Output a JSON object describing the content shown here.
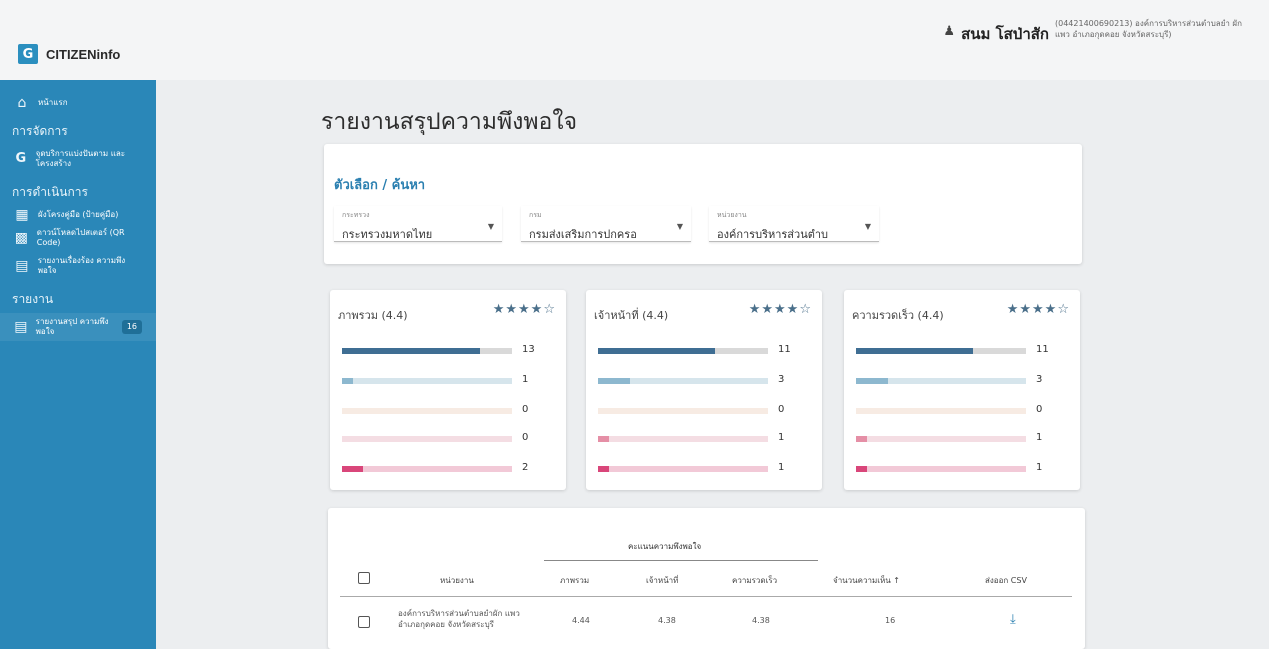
{
  "header": {
    "brand_logo": "G",
    "brand": "CITIZENinfo",
    "user_name": "สนม โสป่าสัก",
    "user_org": "(04421400690213) องค์การบริหารส่วนตำบลยำ ผักแพว อำเภอกุดคอย จังหวัดสระบุรี)"
  },
  "sidebar": {
    "home": "หน้าแรก",
    "section_manage": "การจัดการ",
    "manage_item": "จุดบริการแบ่งปันตาม และโครงสร้าง",
    "section_operation": "การดำเนินการ",
    "op_items": [
      "ผังโครงคู่มือ (ป้ายคู่มือ)",
      "ดาวน์โหลดไปสเตอร์ (QR Code)",
      "รายงานเรื่องร้อง ความพึงพอใจ"
    ],
    "section_report": "รายงาน",
    "report_item": "รายงานสรุป ความพึงพอใจ",
    "report_badge": "16"
  },
  "page": {
    "title": "รายงานสรุปความพึงพอใจ"
  },
  "filter": {
    "title": "ตัวเลือก / ค้นหา",
    "ministry_label": "กระทรวง",
    "ministry_value": "กระทรวงมหาดไทย",
    "department_label": "กรม",
    "department_value": "กรมส่งเสริมการปกครอ",
    "agency_label": "หน่วยงาน",
    "agency_value": "องค์การบริหารส่วนตำบ"
  },
  "ratings": [
    {
      "title": "ภาพรวม (4.4)",
      "stars": "★★★★☆",
      "rating": 4.4,
      "counts": [
        13,
        1,
        0,
        0,
        2
      ]
    },
    {
      "title": "เจ้าหน้าที่ (4.4)",
      "stars": "★★★★☆",
      "rating": 4.4,
      "counts": [
        11,
        3,
        0,
        1,
        1
      ]
    },
    {
      "title": "ความรวดเร็ว (4.4)",
      "stars": "★★★★☆",
      "rating": 4.4,
      "counts": [
        11,
        3,
        0,
        1,
        1
      ]
    }
  ],
  "bar_colors": [
    "#3f6e93",
    "#8db8cf",
    "#f3d9c8",
    "#e58fa6",
    "#d9467a"
  ],
  "bar_track_colors": [
    "#d9d9d9",
    "#d6e5ec",
    "#f7ebe3",
    "#f4dde3",
    "#f2c9d7"
  ],
  "table": {
    "group_header": "คะแนนความพึงพอใจ",
    "col_agency": "หน่วยงาน",
    "col_overall": "ภาพรวม",
    "col_staff": "เจ้าหน้าที่",
    "col_speed": "ความรวดเร็ว",
    "col_count": "จำนวนความเห็น ↑",
    "col_export": "ส่งออก CSV",
    "rows": [
      {
        "agency": "องค์การบริหารส่วนตำบลยำผัก แพว อำเภอกุดคอย จังหวัดสระบุรี",
        "overall": "4.44",
        "staff": "4.38",
        "speed": "4.38",
        "count": "16"
      }
    ]
  }
}
